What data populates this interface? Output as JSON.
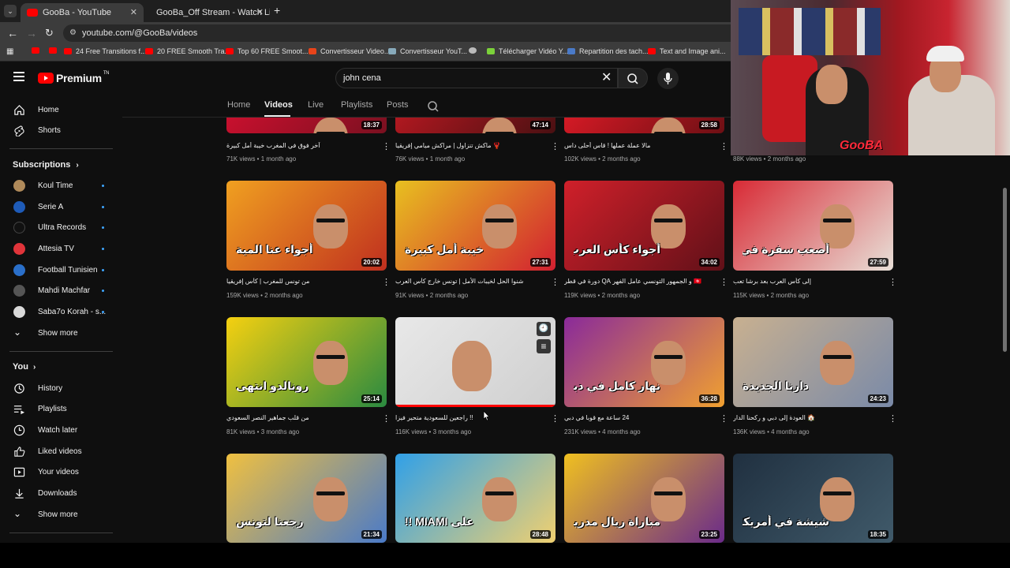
{
  "browser": {
    "tabs": [
      {
        "title": "GooBa - YouTube",
        "active": true
      },
      {
        "title": "GooBa_Off Stream - Watch Live",
        "active": false
      }
    ],
    "new_tab": "+",
    "url": "youtube.com/@GooBa/videos",
    "bookmarks": [
      {
        "label": ""
      },
      {
        "label": ""
      },
      {
        "label": "24 Free Transitions f..."
      },
      {
        "label": "20 FREE Smooth Tra..."
      },
      {
        "label": "Top 60 FREE Smoot..."
      },
      {
        "label": "Convertisseur Video..."
      },
      {
        "label": "Convertisseur YouT..."
      },
      {
        "label": ""
      },
      {
        "label": "Télécharger Vidéo Y..."
      },
      {
        "label": "Repartition des tach..."
      },
      {
        "label": "Text and Image ani..."
      }
    ]
  },
  "header": {
    "logo": "Premium",
    "logo_sup": "TN",
    "search_value": "john cena"
  },
  "channel_tabs": [
    "Home",
    "Videos",
    "Live",
    "Playlists",
    "Posts"
  ],
  "sidebar": {
    "main": [
      {
        "label": "Home",
        "icon": "home-icon"
      },
      {
        "label": "Shorts",
        "icon": "shorts-icon"
      }
    ],
    "subscriptions_title": "Subscriptions",
    "subscriptions": [
      {
        "label": "Koul Time",
        "color": "#b08a5a"
      },
      {
        "label": "Serie A",
        "color": "#1e5bb8"
      },
      {
        "label": "Ultra Records",
        "color": "#111111"
      },
      {
        "label": "Attesia TV",
        "color": "#e0343a"
      },
      {
        "label": "Football Tunisien",
        "color": "#2a6fc9"
      },
      {
        "label": "Mahdi Machfar",
        "color": "#555555"
      },
      {
        "label": "Saba7o Korah - s...",
        "color": "#d9d9d9"
      }
    ],
    "show_more": "Show more",
    "you_title": "You",
    "you_items": [
      {
        "label": "History",
        "icon": "history-icon"
      },
      {
        "label": "Playlists",
        "icon": "playlists-icon"
      },
      {
        "label": "Watch later",
        "icon": "watch-later-icon"
      },
      {
        "label": "Liked videos",
        "icon": "like-icon"
      },
      {
        "label": "Your videos",
        "icon": "your-videos-icon"
      },
      {
        "label": "Downloads",
        "icon": "download-icon"
      }
    ],
    "show_more_2": "Show more"
  },
  "videos": [
    {
      "title": "آخر فوق في المغرب خيبة أمل كبيرة",
      "views": "71K views",
      "ago": "1 month ago",
      "duration": "18:37",
      "overlay": "",
      "colors": [
        "#c8102e",
        "#7a1020"
      ]
    },
    {
      "title": "🦞 ماكش تنزاول | مراكش ميامي إفريقيا",
      "views": "76K views",
      "ago": "1 month ago",
      "duration": "47:14",
      "overlay": "",
      "colors": [
        "#b01820",
        "#4a1012"
      ]
    },
    {
      "title": "مالا عملة عملها ! قاس أحلى داس",
      "views": "102K views",
      "ago": "2 months ago",
      "duration": "28:58",
      "overlay": "",
      "colors": [
        "#d41a25",
        "#6d0f14"
      ]
    },
    {
      "title": "",
      "views": "88K views",
      "ago": "2 months ago",
      "duration": "",
      "overlay": "",
      "colors": [
        "#333333",
        "#222222"
      ]
    },
    {
      "title": "من تونس للمغرب | كأس إفريقيا",
      "views": "159K views",
      "ago": "2 months ago",
      "duration": "20:02",
      "overlay": "أجواء عنا المية",
      "colors": [
        "#f0a020",
        "#c0301f"
      ]
    },
    {
      "title": "شنوا الحل لخيبات الأمل | تونس خارج كأس العرب",
      "views": "91K views",
      "ago": "2 months ago",
      "duration": "27:31",
      "overlay": "خيبة أمل كبيرة",
      "colors": [
        "#e8c020",
        "#d22030"
      ]
    },
    {
      "title": "🇹🇳 و الجمهور التونسي عامل الفهر QA دورة في قطر",
      "views": "119K views",
      "ago": "2 months ago",
      "duration": "34:02",
      "overlay": "أجواء كأس العرب",
      "colors": [
        "#d0202a",
        "#601018"
      ]
    },
    {
      "title": "إلى كأس العرب بعد برشا تعب",
      "views": "115K views",
      "ago": "2 months ago",
      "duration": "27:59",
      "overlay": "أصعب سفرة في حياتي",
      "colors": [
        "#d82a35",
        "#e8e0d8"
      ]
    },
    {
      "title": "من قلب جماهير النصر السعودي",
      "views": "81K views",
      "ago": "3 months ago",
      "duration": "25:14",
      "overlay": "رونالدو انتهى",
      "colors": [
        "#f5d010",
        "#2a8a40"
      ]
    },
    {
      "title": "!! راجعين للسعودية متحير فيزا",
      "views": "116K views",
      "ago": "3 months ago",
      "duration": "",
      "overlay": "",
      "colors": [
        "#e8e8e8",
        "#cfcfcf"
      ]
    },
    {
      "title": "24 ساعة مع قوبا في دبي",
      "views": "231K views",
      "ago": "4 months ago",
      "duration": "36:28",
      "overlay": "نهار كامل في دبي",
      "colors": [
        "#8a2a9a",
        "#f0a030"
      ]
    },
    {
      "title": "🏠 العودة إلى دبي و ركحنا الدار",
      "views": "136K views",
      "ago": "4 months ago",
      "duration": "24:23",
      "overlay": "دارنا الجديدة",
      "colors": [
        "#c8b090",
        "#7a8aa8"
      ]
    },
    {
      "title": "",
      "views": "",
      "ago": "",
      "duration": "21:34",
      "overlay": "رجعنا لتونس",
      "colors": [
        "#f0c040",
        "#4a7ac8"
      ]
    },
    {
      "title": "",
      "views": "",
      "ago": "",
      "duration": "28:48",
      "overlay": "على MIAMI !!",
      "colors": [
        "#30a0e8",
        "#f0d070"
      ]
    },
    {
      "title": "",
      "views": "",
      "ago": "",
      "duration": "23:25",
      "overlay": "مباراة ريال مدريد",
      "colors": [
        "#f0c020",
        "#6a2a8a"
      ]
    },
    {
      "title": "",
      "views": "",
      "ago": "",
      "duration": "18:35",
      "overlay": "شيشة في أمريكا",
      "colors": [
        "#203040",
        "#405a6a"
      ]
    }
  ],
  "webcam": {
    "label": "GooBA"
  }
}
